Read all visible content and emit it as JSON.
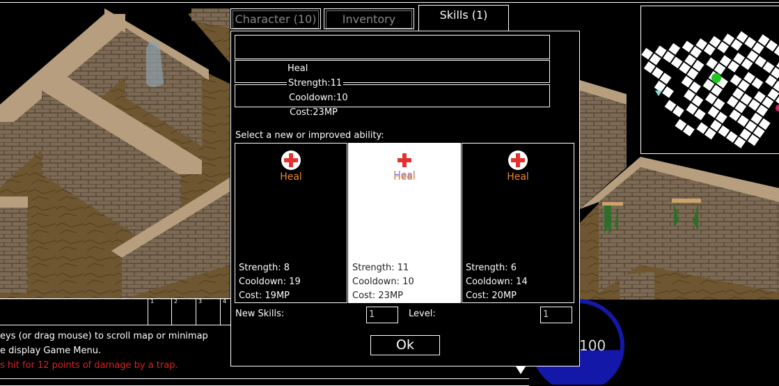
{
  "tabs": [
    {
      "label": "Character (10)"
    },
    {
      "label": "Inventory"
    },
    {
      "label": "Skills (1)"
    }
  ],
  "current_skill": {
    "name": "Heal",
    "strength": "Strength:11",
    "cooldown": "Cooldown:10",
    "cost": "Cost:23MP"
  },
  "select_prompt": "Select a new or improved ability:",
  "choices": [
    {
      "name": "Heal",
      "strength": "Strength: 8",
      "cooldown": "Cooldown: 19",
      "cost": "Cost: 19MP"
    },
    {
      "name": "Heal",
      "strength": "Strength: 11",
      "cooldown": "Cooldown: 10",
      "cost": "Cost: 23MP"
    },
    {
      "name": "Heal",
      "strength": "Strength: 6",
      "cooldown": "Cooldown: 14",
      "cost": "Cost: 20MP"
    }
  ],
  "new_skills_label": "New Skills:",
  "new_skills_value": "1",
  "level_label": "Level:",
  "level_value": "1",
  "ok_label": "Ok",
  "hotbar_slots": [
    "1",
    "2",
    "3",
    "4"
  ],
  "messages": [
    {
      "text": "eys (or drag mouse) to scroll map or minimap",
      "color": "#ffffff"
    },
    {
      "text": "e display Game Menu.",
      "color": "#ffffff"
    },
    {
      "text": "s hit for 12 points of damage by a trap.",
      "color": "#e02020"
    }
  ],
  "mana_value": "100",
  "mana_fill_fraction": 0.45,
  "colors": {
    "stone": "#8a7660",
    "floor": "#6e5630",
    "mana": "#1418a8",
    "damage_text": "#e02020"
  }
}
